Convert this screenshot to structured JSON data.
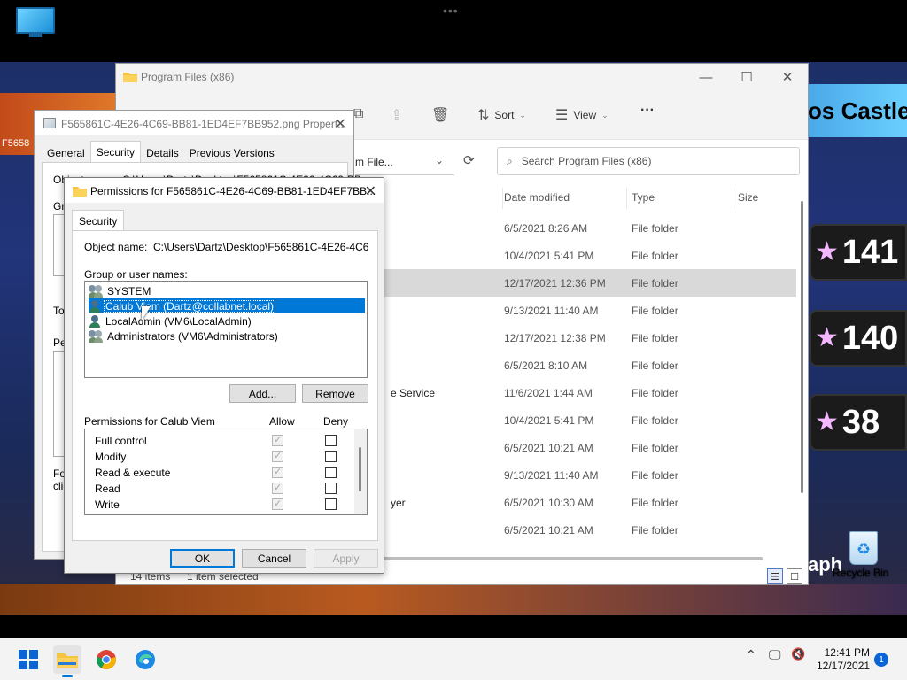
{
  "desktop": {
    "icons": [
      {
        "label": "My Computer"
      },
      {
        "label": "Recycle Bin"
      }
    ],
    "wallpaper": {
      "castle_text": "os Castle",
      "scores": [
        "141",
        "140",
        "38"
      ],
      "graph_text": "aph",
      "left_fragment": "F5658"
    }
  },
  "explorer": {
    "title": "Program Files (x86)",
    "toolbar": {
      "sort_label": "Sort",
      "view_label": "View",
      "more_label": "···"
    },
    "address_fragment": "m File...",
    "search_placeholder": "Search Program Files (x86)",
    "columns": {
      "date": "Date modified",
      "type": "Type",
      "size": "Size"
    },
    "rows": [
      {
        "name": "",
        "date": "6/5/2021 8:26 AM",
        "type": "File folder"
      },
      {
        "name": "",
        "date": "10/4/2021 5:41 PM",
        "type": "File folder"
      },
      {
        "name": "",
        "date": "12/17/2021 12:36 PM",
        "type": "File folder",
        "selected": true
      },
      {
        "name": "",
        "date": "9/13/2021 11:40 AM",
        "type": "File folder"
      },
      {
        "name": "",
        "date": "12/17/2021 12:38 PM",
        "type": "File folder"
      },
      {
        "name": "",
        "date": "6/5/2021 8:10 AM",
        "type": "File folder"
      },
      {
        "name": "e Service",
        "date": "11/6/2021 1:44 AM",
        "type": "File folder"
      },
      {
        "name": "",
        "date": "10/4/2021 5:41 PM",
        "type": "File folder"
      },
      {
        "name": "",
        "date": "6/5/2021 10:21 AM",
        "type": "File folder"
      },
      {
        "name": "",
        "date": "9/13/2021 11:40 AM",
        "type": "File folder"
      },
      {
        "name": "yer",
        "date": "6/5/2021 10:30 AM",
        "type": "File folder"
      },
      {
        "name": "",
        "date": "6/5/2021 10:21 AM",
        "type": "File folder"
      }
    ],
    "status": {
      "items": "14 items",
      "selected": "1 item selected"
    }
  },
  "properties": {
    "title": "F565861C-4E26-4C69-BB81-1ED4EF7BB952.png Propert...",
    "tabs": [
      "General",
      "Security",
      "Details",
      "Previous Versions"
    ],
    "fragments": {
      "object": "Object name:",
      "group": "Gro",
      "to": "To",
      "pe": "Pe",
      "for": "For",
      "clic": "clic"
    },
    "object_path_fragment": "C:\\Users\\Dartz\\Desktop\\F565861C-4E26-4C69-BB"
  },
  "permissions": {
    "title": "Permissions for F565861C-4E26-4C69-BB81-1ED4EF7BB...",
    "tab": "Security",
    "object_name_label": "Object name:",
    "object_name_value": "C:\\Users\\Dartz\\Desktop\\F565861C-4E26-4C69-BB",
    "group_label": "Group or user names:",
    "users": [
      {
        "name": "SYSTEM",
        "kind": "group"
      },
      {
        "name": "Calub Viem (Dartz@collabnet.local)",
        "kind": "user",
        "selected": true
      },
      {
        "name": "LocalAdmin (VM6\\LocalAdmin)",
        "kind": "user"
      },
      {
        "name": "Administrators (VM6\\Administrators)",
        "kind": "group"
      }
    ],
    "add_label": "Add...",
    "remove_label": "Remove",
    "perms_for_label": "Permissions for Calub Viem",
    "allow_label": "Allow",
    "deny_label": "Deny",
    "permissions": [
      {
        "name": "Full control",
        "allow": true,
        "deny": false
      },
      {
        "name": "Modify",
        "allow": true,
        "deny": false
      },
      {
        "name": "Read & execute",
        "allow": true,
        "deny": false
      },
      {
        "name": "Read",
        "allow": true,
        "deny": false
      },
      {
        "name": "Write",
        "allow": true,
        "deny": false
      }
    ],
    "ok_label": "OK",
    "cancel_label": "Cancel",
    "apply_label": "Apply"
  },
  "taskbar": {
    "time": "12:41 PM",
    "date": "12/17/2021",
    "notification_count": "1"
  },
  "colors": {
    "accent": "#0078d7",
    "selection_row": "#d9d9d9"
  }
}
